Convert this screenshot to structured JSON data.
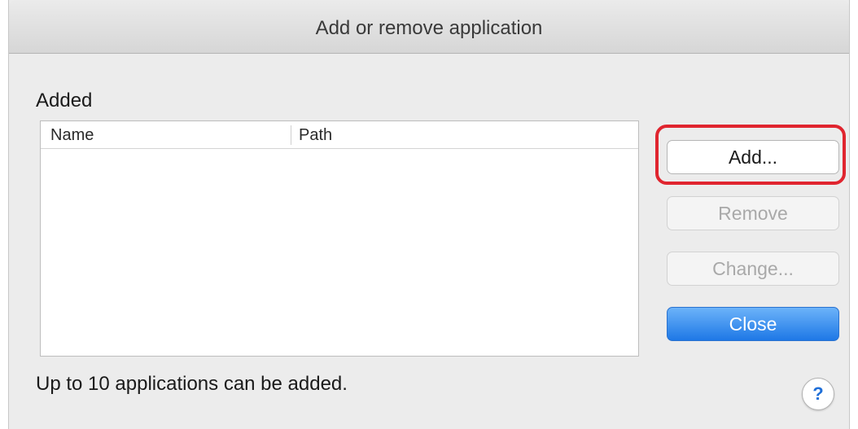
{
  "window": {
    "title": "Add or remove application"
  },
  "section": {
    "label": "Added"
  },
  "table": {
    "columns": [
      "Name",
      "Path"
    ],
    "rows": []
  },
  "buttons": {
    "add": "Add...",
    "remove": "Remove",
    "change": "Change...",
    "close": "Close"
  },
  "footer": {
    "note": "Up to 10 applications can be added.",
    "help_icon": "question-mark-icon",
    "help_glyph": "?"
  },
  "colors": {
    "highlight": "#e0252f",
    "primary_button": "#1e78e6"
  }
}
